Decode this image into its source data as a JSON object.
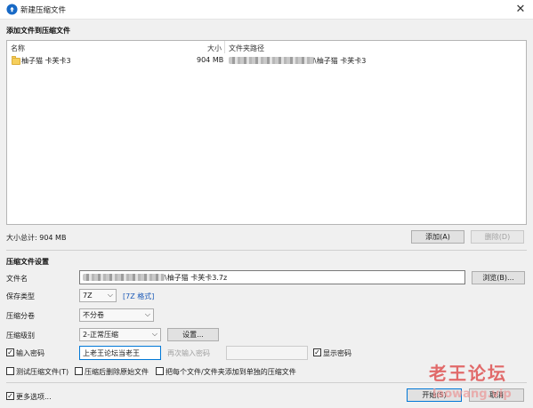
{
  "window": {
    "title": "新建压缩文件",
    "close_glyph": "✕",
    "app_icon": "bandizip-icon"
  },
  "add_section": {
    "title": "添加文件到压缩文件",
    "columns": {
      "name": "名称",
      "size": "大小",
      "path": "文件夹路径"
    },
    "rows": [
      {
        "name": "柚子猫 卡芙卡3",
        "size": "904 MB",
        "path_suffix": "\\柚子猫 卡芙卡3"
      }
    ],
    "total": "大小总计: 904 MB",
    "add_button": "添加(A)",
    "delete_button": "删除(D)"
  },
  "settings": {
    "title": "压缩文件设置",
    "filename_label": "文件名",
    "filename_value": "\\柚子猫 卡芙卡3.7z",
    "browse_button": "浏览(B)...",
    "save_type_label": "保存类型",
    "save_type_value": "7Z",
    "save_type_link": "[7Z 格式]",
    "split_label": "压缩分卷",
    "split_value": "不分卷",
    "level_label": "压缩级别",
    "level_value": "2-正常压缩",
    "settings_button": "设置...",
    "password_label": "输入密码",
    "password_value": "上老王论坛当老王",
    "password_checked": true,
    "reenter_label": "再次输入密码",
    "show_password_label": "显示密码",
    "show_password_checked": true,
    "test_label": "测试压缩文件(T)",
    "delete_original_label": "压缩后删除原始文件",
    "each_separately_label": "把每个文件/文件夹添加到单独的压缩文件"
  },
  "footer": {
    "more_options_label": "更多选项...",
    "more_options_checked": true,
    "start_button": "开始(S)",
    "cancel_button": "取消"
  },
  "watermark": {
    "text": "老王论坛",
    "sub": "laowang.vip"
  },
  "colors": {
    "accent": "#0078d7",
    "link": "#1c5ab7",
    "window_bg": "#f0f0f0"
  }
}
